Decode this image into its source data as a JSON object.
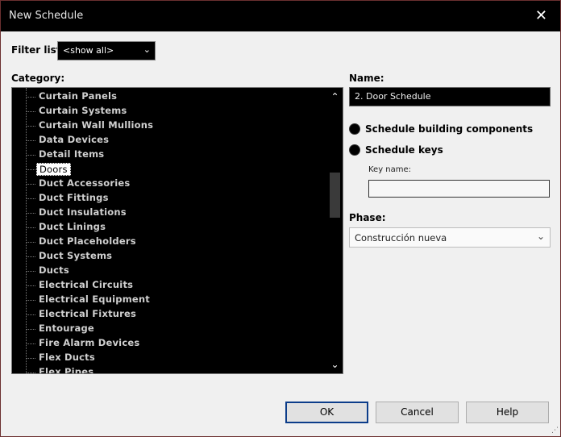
{
  "window": {
    "title": "New Schedule",
    "close_glyph": "✕"
  },
  "filter": {
    "label": "Filter list:",
    "value": "<show all>",
    "chevron": "⌄"
  },
  "category": {
    "label": "Category:",
    "items": [
      "Curtain Panels",
      "Curtain Systems",
      "Curtain Wall Mullions",
      "Data Devices",
      "Detail Items",
      "Doors",
      "Duct Accessories",
      "Duct Fittings",
      "Duct Insulations",
      "Duct Linings",
      "Duct Placeholders",
      "Duct Systems",
      "Ducts",
      "Electrical Circuits",
      "Electrical Equipment",
      "Electrical Fixtures",
      "Entourage",
      "Fire Alarm Devices",
      "Flex Ducts",
      "Flex Pipes"
    ],
    "selected": "Doors",
    "scroll_up": "⌃",
    "scroll_down": "⌄"
  },
  "name": {
    "label": "Name:",
    "value": "2. Door Schedule"
  },
  "options": {
    "building_components": "Schedule building components",
    "keys": "Schedule keys",
    "key_name_label": "Key name:"
  },
  "phase": {
    "label": "Phase:",
    "value": "Construcción nueva",
    "chevron": "⌄"
  },
  "buttons": {
    "ok": "OK",
    "cancel": "Cancel",
    "help": "Help"
  },
  "grip_glyph": "⋰"
}
